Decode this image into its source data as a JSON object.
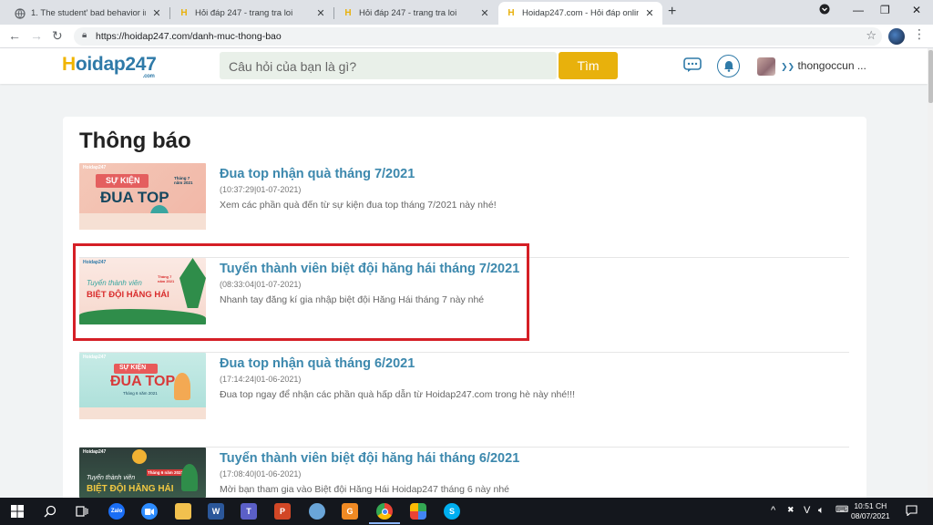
{
  "browser": {
    "tabs": [
      {
        "title": "1. The student' bad behavior in c",
        "favicon": "globe-icon",
        "active": false
      },
      {
        "title": "Hỏi đáp 247 - trang tra loi",
        "favicon": "hoidap-favicon",
        "active": false
      },
      {
        "title": "Hỏi đáp 247 - trang tra loi",
        "favicon": "hoidap-favicon",
        "active": false
      },
      {
        "title": "Hoidap247.com - Hỏi đáp online",
        "favicon": "hoidap-favicon",
        "active": true
      }
    ],
    "url": "https://hoidap247.com/danh-muc-thong-bao"
  },
  "site": {
    "logo_h": "H",
    "logo_rest": "oidap247",
    "logo_com": ".com",
    "search_placeholder": "Câu hỏi của bạn là gì?",
    "search_button": "Tìm",
    "username": "thongoccun ..."
  },
  "page": {
    "title": "Thông báo",
    "items": [
      {
        "title": "Đua top nhận quà tháng 7/2021",
        "time": "(10:37:29|01-07-2021)",
        "desc": "Xem các phần quà đến từ sự kiện đua top tháng 7/2021 này nhé!",
        "thumb": {
          "brand": "Hoidap247",
          "line1": "SỰ KIỆN",
          "line2": "ĐUA TOP",
          "line3": "Tháng 7 năm 2021"
        }
      },
      {
        "title": "Tuyển thành viên biệt đội hăng hái tháng 7/2021",
        "time": "(08:33:04|01-07-2021)",
        "desc": "Nhanh tay đăng kí gia nhập biệt đội Hăng Hái tháng 7 này nhé",
        "thumb": {
          "brand": "Hoidap247",
          "line1": "Tuyển thành viên",
          "line2": "BIỆT ĐỘI HĂNG HÁI",
          "line3": "Tháng 7 năm 2021"
        }
      },
      {
        "title": "Đua top nhận quà tháng 6/2021",
        "time": "(17:14:24|01-06-2021)",
        "desc": "Đua top ngay để nhận các phần quà hấp dẫn từ Hoidap247.com trong hè này nhé!!!",
        "thumb": {
          "brand": "Hoidap247",
          "line1": "SỰ KIỆN",
          "line2": "ĐUA TOP",
          "line3": "Tháng 6 năm 2021"
        }
      },
      {
        "title": "Tuyển thành viên biệt đội hăng hái tháng 6/2021",
        "time": "(17:08:40|01-06-2021)",
        "desc": "Mời bạn tham gia vào Biệt đội Hăng Hái Hoidap247 tháng 6 này nhé",
        "thumb": {
          "brand": "Hoidap247",
          "line1": "Tuyển thành viên",
          "line2": "BIỆT ĐỘI HĂNG HÁI",
          "line3": "Tháng 6 năm 2021"
        }
      }
    ]
  },
  "taskbar": {
    "tray_lang": "V",
    "time": "10:51 CH",
    "date": "08/07/2021",
    "apps": [
      "zalo-icon",
      "zoom-icon",
      "file-explorer-icon",
      "word-icon",
      "teams-icon",
      "powerpoint-icon",
      "paint-icon",
      "game-icon",
      "chrome-icon",
      "photos-icon",
      "skype-icon"
    ]
  },
  "colors": {
    "accent": "#3c88ad",
    "search_button": "#e8b10c",
    "highlight": "#d51f26"
  }
}
